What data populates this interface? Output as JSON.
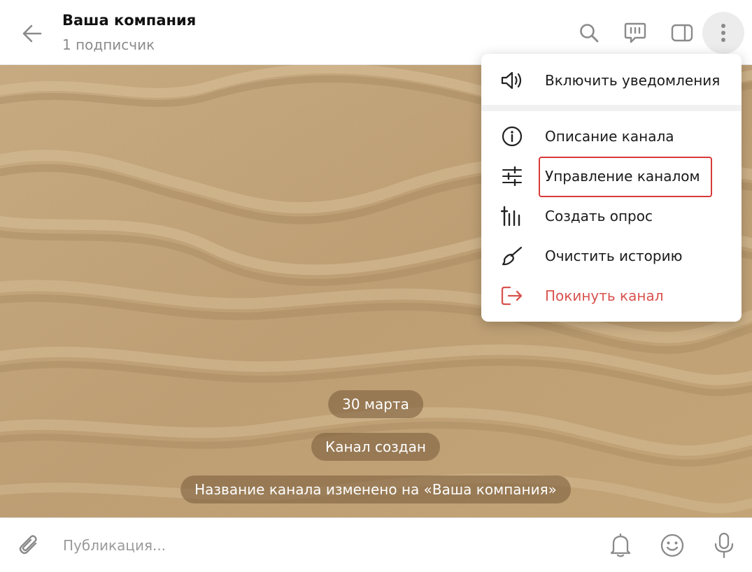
{
  "header": {
    "title": "Ваша компания",
    "subtitle": "1 подписчик",
    "icons": [
      "arrow-left-icon",
      "search-icon",
      "comment-icon",
      "sidebar-toggle-icon",
      "more-vertical-icon"
    ]
  },
  "menu": {
    "items": [
      {
        "label": "Включить уведомления",
        "icon": "speaker-icon"
      },
      {
        "label": "Описание канала",
        "icon": "info-icon"
      },
      {
        "label": "Управление каналом",
        "icon": "sliders-icon",
        "highlighted": true
      },
      {
        "label": "Создать опрос",
        "icon": "poll-icon"
      },
      {
        "label": "Очистить историю",
        "icon": "broom-icon"
      },
      {
        "label": "Покинуть канал",
        "icon": "leave-icon",
        "danger": true
      }
    ]
  },
  "chat": {
    "service_messages": [
      "30 марта",
      "Канал создан",
      "Название канала изменено на «Ваша компания»"
    ]
  },
  "composer": {
    "placeholder": "Публикация...",
    "icons": [
      "paperclip-icon",
      "bell-icon",
      "emoji-icon",
      "microphone-icon"
    ]
  },
  "colors": {
    "accent_icon": "#8a8a8a",
    "danger": "#d9534f",
    "highlight_border": "#d83a3a",
    "sand": "#c8a87b"
  }
}
